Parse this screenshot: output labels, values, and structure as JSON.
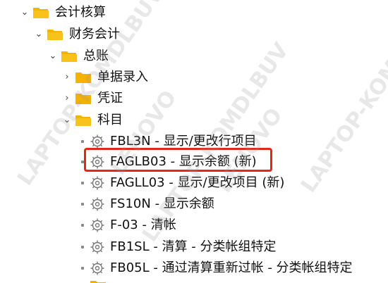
{
  "tree": {
    "root": {
      "label": "会计核算",
      "icon": "folder-open-icon"
    },
    "level1": {
      "label": "财务会计",
      "icon": "folder-open-icon"
    },
    "level2": {
      "label": "总账",
      "icon": "folder-open-icon"
    },
    "level3": [
      {
        "label": "单据录入",
        "icon": "folder-icon",
        "expanded": false
      },
      {
        "label": "凭证",
        "icon": "folder-icon",
        "expanded": false
      },
      {
        "label": "科目",
        "icon": "folder-open-icon",
        "expanded": true
      }
    ],
    "transactions": [
      {
        "code": "FBL3N",
        "sep": " - ",
        "desc": "显示/更改行项目"
      },
      {
        "code": "FAGLB03",
        "sep": " - ",
        "desc": "显示余额 (新)"
      },
      {
        "code": "FAGLL03",
        "sep": " - ",
        "desc": "显示/更改项目 (新)"
      },
      {
        "code": "FS10N",
        "sep": " - ",
        "desc": "显示余额"
      },
      {
        "code": "F-03",
        "sep": " - ",
        "desc": "清帐"
      },
      {
        "code": "FB1SL",
        "sep": " - ",
        "desc": "清算 - 分类帐组特定"
      },
      {
        "code": "FB05L",
        "sep": " - ",
        "desc": "通过清算重新过帐 - 分类帐组特定"
      }
    ]
  },
  "watermark": {
    "text1": "LAPTOP-KOMDLBUV",
    "text2": "LENOVO"
  },
  "colors": {
    "folder": "#f5b301",
    "highlight": "#e5261a"
  }
}
